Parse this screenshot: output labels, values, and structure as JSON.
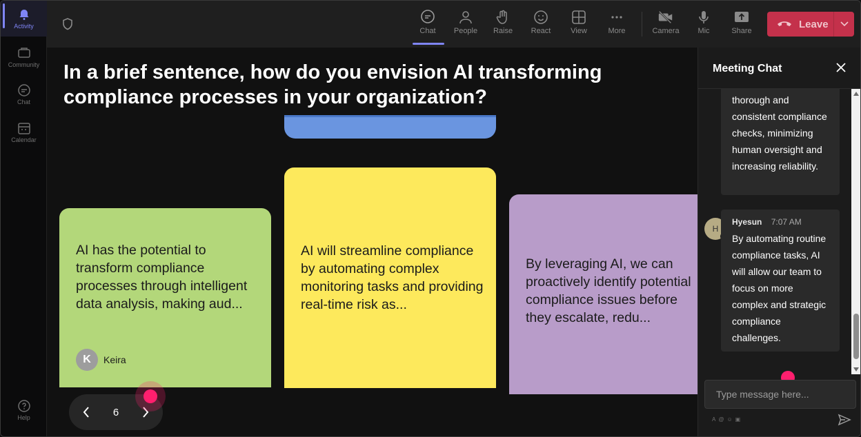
{
  "rail": {
    "items": [
      {
        "label": "Activity",
        "icon": "bell-icon"
      },
      {
        "label": "Community",
        "icon": "community-icon"
      },
      {
        "label": "Chat",
        "icon": "chat-icon"
      },
      {
        "label": "Calendar",
        "icon": "calendar-icon"
      }
    ],
    "help_label": "Help"
  },
  "toolbar": {
    "chat": "Chat",
    "people": "People",
    "raise": "Raise",
    "react": "React",
    "view": "View",
    "more": "More",
    "camera": "Camera",
    "mic": "Mic",
    "share": "Share",
    "leave": "Leave"
  },
  "stage": {
    "question": "In a brief sentence, how do you envision AI transforming compliance processes in your organization?",
    "cards": [
      {
        "text": "AI has the potential to transform compliance processes through intelligent data analysis, making aud...",
        "author": "Keira",
        "initial": "K",
        "color": "#b3d77a"
      },
      {
        "text": "AI will streamline compliance by automating complex monitoring tasks and providing real-time risk as...",
        "color": "#fde95c"
      },
      {
        "text": "By leveraging AI, we can proactively identify potential compliance issues before they escalate, redu...",
        "color": "#b89cc9"
      }
    ],
    "page_number": "6"
  },
  "chat": {
    "title": "Meeting Chat",
    "message1_tail": "thorough and consistent compliance checks, minimizing human oversight and increasing reliability.",
    "message2": {
      "sender": "Hyesun",
      "initial": "H",
      "time": "7:07 AM",
      "text": "By automating routine compliance tasks, AI will allow our team to focus on more complex and strategic compliance challenges."
    },
    "input_placeholder": "Type message here...",
    "format_icons": [
      "A",
      "@",
      "☺",
      "▣"
    ]
  },
  "colors": {
    "leave": "#c4314b",
    "accent": "#7f85f5",
    "cursor": "#ff1f6e"
  }
}
